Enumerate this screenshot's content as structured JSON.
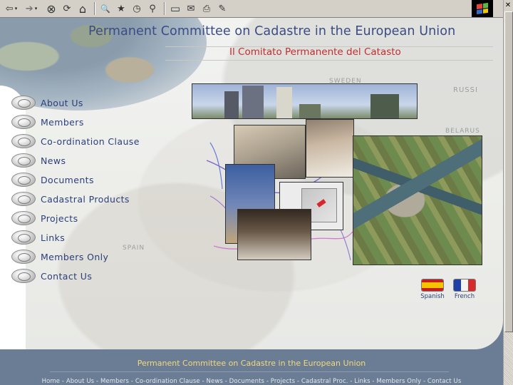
{
  "toolbar": {
    "buttons": [
      {
        "name": "back",
        "glyph": "⇦"
      },
      {
        "name": "forward",
        "glyph": "➔"
      },
      {
        "name": "stop",
        "glyph": "⊗"
      },
      {
        "name": "refresh",
        "glyph": "⟳"
      },
      {
        "name": "home",
        "glyph": "⌂"
      },
      {
        "name": "search",
        "glyph": "🔍"
      },
      {
        "name": "favorites",
        "glyph": "★"
      },
      {
        "name": "history",
        "glyph": "◷"
      },
      {
        "name": "channels",
        "glyph": "⚲"
      },
      {
        "name": "fullscreen",
        "glyph": "▭"
      },
      {
        "name": "mail",
        "glyph": "✉"
      },
      {
        "name": "print",
        "glyph": "⎙"
      },
      {
        "name": "edit",
        "glyph": "✎"
      }
    ],
    "dropdown_glyph": "▾",
    "close_glyph": "✕",
    "scroll_up_glyph": "▲"
  },
  "header": {
    "title": "Permanent Committee on Cadastre in the European Union",
    "subtitle": "Il Comitato Permanente del Catasto"
  },
  "map_labels": [
    "SWEDEN",
    "RUSSI",
    "SPAIN",
    "BELARUS"
  ],
  "nav": {
    "items": [
      {
        "label": "About Us"
      },
      {
        "label": "Members"
      },
      {
        "label": "Co-ordination Clause"
      },
      {
        "label": "News"
      },
      {
        "label": "Documents"
      },
      {
        "label": "Cadastral Products"
      },
      {
        "label": "Projects"
      },
      {
        "label": "Links"
      },
      {
        "label": "Members Only"
      },
      {
        "label": "Contact Us"
      }
    ]
  },
  "languages": {
    "spanish": "Spanish",
    "french": "French"
  },
  "footer": {
    "title": "Permanent Committee on Cadastre in the European Union",
    "links": "Home - About Us - Members - Co-ordination Clause - News - Documents - Projects - Cadastral Proc. - Links - Members Only - Contact Us"
  },
  "colors": {
    "title": "#3b4c85",
    "subtitle": "#c32d2d",
    "footer_bg": "#6b7d94",
    "footer_title": "#f4d978"
  }
}
